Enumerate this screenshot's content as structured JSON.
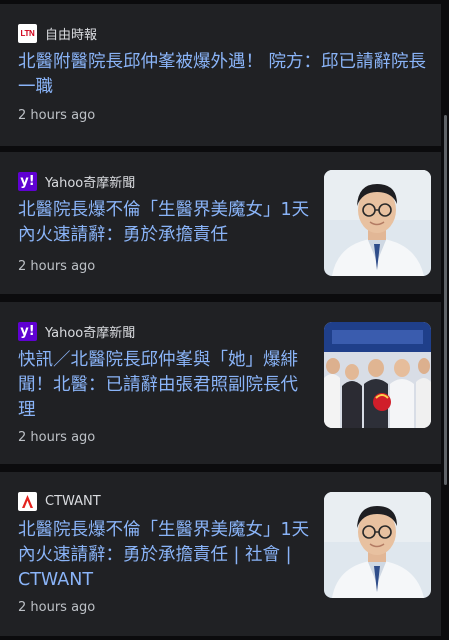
{
  "articles": [
    {
      "source": "自由時報",
      "logo_icon": "ltn-logo-icon",
      "logo_text": "LTN",
      "title": "北醫附醫院長邱仲峯被爆外遇！ 院方：邱已請辭院長一職",
      "time": "2 hours ago",
      "has_thumbnail": false
    },
    {
      "source": "Yahoo奇摩新聞",
      "logo_icon": "yahoo-logo-icon",
      "logo_text": "y!",
      "title": "北醫院長爆不倫「生醫界美魔女」1天內火速請辭：勇於承擔責任",
      "time": "2 hours ago",
      "has_thumbnail": true,
      "thumbnail": "doctor-portrait"
    },
    {
      "source": "Yahoo奇摩新聞",
      "logo_icon": "yahoo-logo-icon",
      "logo_text": "y!",
      "title": "快訊／北醫院長邱仲峯與「她」爆緋聞！北醫：已請辭由張君照副院長代理",
      "time": "2 hours ago",
      "has_thumbnail": true,
      "thumbnail": "handover-ceremony-photo"
    },
    {
      "source": "CTWANT",
      "logo_icon": "ctwant-logo-icon",
      "title": "北醫院長爆不倫「生醫界美魔女」1天內火速請辭：勇於承擔責任 | 社會 | CTWANT",
      "time": "2 hours ago",
      "has_thumbnail": true,
      "thumbnail": "doctor-portrait"
    }
  ],
  "colors": {
    "background": "#0b0b0d",
    "card": "#202124",
    "headline": "#8ab4f8",
    "meta": "#bdc1c6",
    "yahoo_purple": "#6001d2",
    "ltn_red": "#d0021b",
    "ctwant_red": "#e4231e"
  }
}
